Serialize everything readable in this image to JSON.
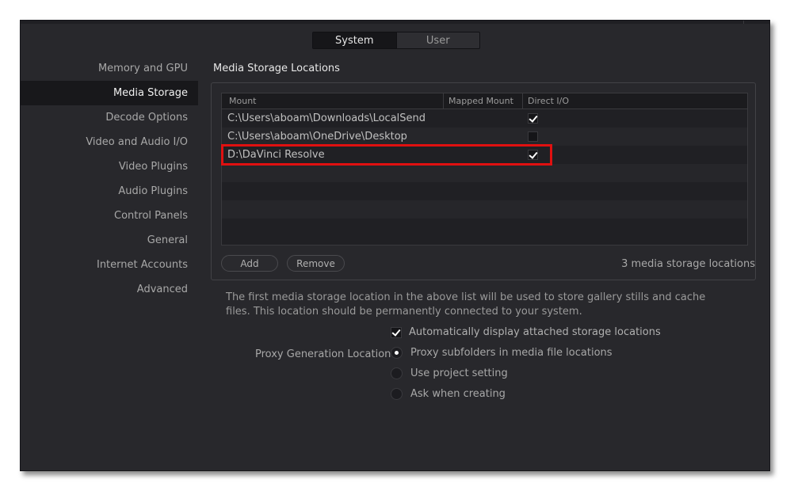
{
  "tabs": [
    {
      "label": "System",
      "active": true
    },
    {
      "label": "User",
      "active": false
    }
  ],
  "sidebar": {
    "items": [
      {
        "label": "Memory and GPU",
        "active": false
      },
      {
        "label": "Media Storage",
        "active": true
      },
      {
        "label": "Decode Options",
        "active": false
      },
      {
        "label": "Video and Audio I/O",
        "active": false
      },
      {
        "label": "Video Plugins",
        "active": false
      },
      {
        "label": "Audio Plugins",
        "active": false
      },
      {
        "label": "Control Panels",
        "active": false
      },
      {
        "label": "General",
        "active": false
      },
      {
        "label": "Internet Accounts",
        "active": false
      },
      {
        "label": "Advanced",
        "active": false
      }
    ]
  },
  "main": {
    "section_title": "Media Storage Locations",
    "table": {
      "headers": [
        "Mount",
        "Mapped Mount",
        "Direct I/O"
      ],
      "rows": [
        {
          "mount": "C:\\Users\\aboam\\Downloads\\LocalSend",
          "mapped": "",
          "direct_io": true
        },
        {
          "mount": "C:\\Users\\aboam\\OneDrive\\Desktop",
          "mapped": "",
          "direct_io": false
        },
        {
          "mount": "D:\\DaVinci Resolve",
          "mapped": "",
          "direct_io": true
        }
      ]
    },
    "add_label": "Add",
    "remove_label": "Remove",
    "count_text": "3 media storage locations",
    "description": "The first media storage location in the above list will be used to store gallery stills and cache files. This location should be permanently connected to your system.",
    "auto_display": {
      "label": "Automatically display attached storage locations",
      "checked": true
    },
    "proxy": {
      "label": "Proxy Generation Location",
      "options": [
        {
          "label": "Proxy subfolders in media file locations",
          "selected": true
        },
        {
          "label": "Use project setting",
          "selected": false
        },
        {
          "label": "Ask when creating",
          "selected": false
        }
      ]
    }
  },
  "colors": {
    "background": "#28282c",
    "highlight": "#e01010",
    "active_sidebar": "#18181b"
  }
}
